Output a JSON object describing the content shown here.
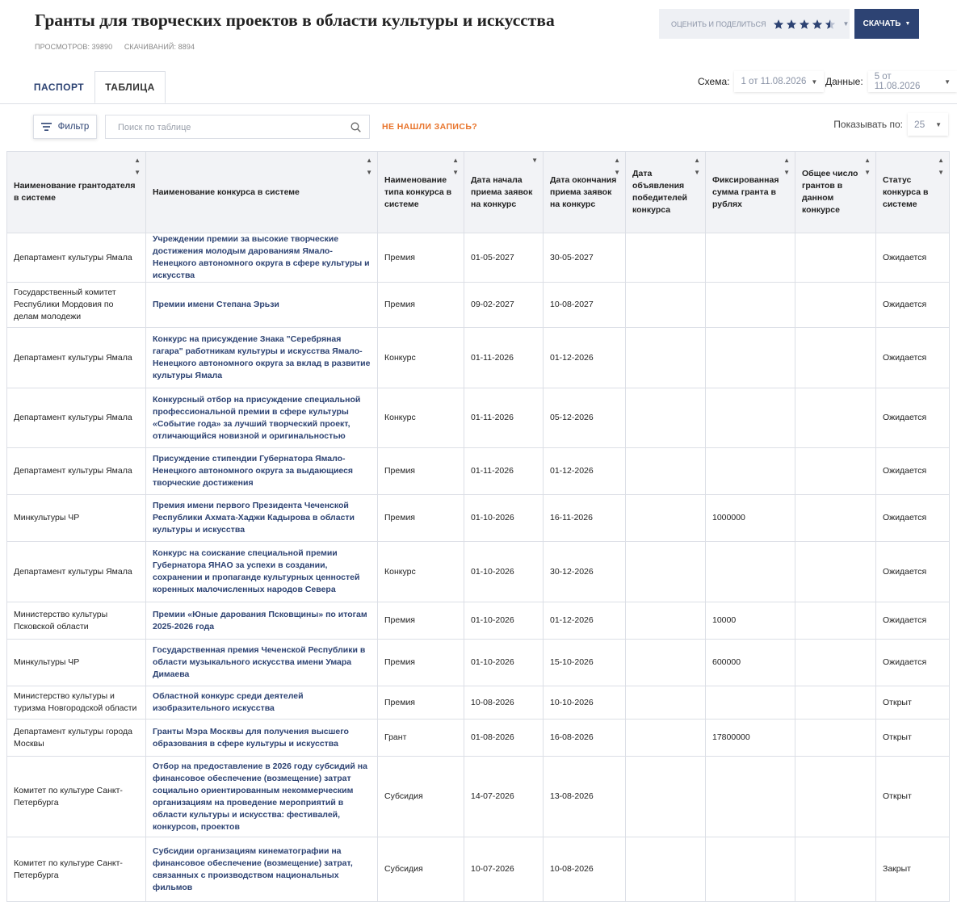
{
  "page": {
    "title": "Гранты для творческих проектов в области культуры и искусства",
    "views_label": "ПРОСМОТРОВ: 39890",
    "downloads_label": "СКАЧИВАНИЙ: 8894"
  },
  "toolbar": {
    "rate_label": "ОЦЕНИТЬ И ПОДЕЛИТЬСЯ",
    "rating_stars": 4.5,
    "download_label": "СКАЧАТЬ"
  },
  "tabs": {
    "passport": "ПАСПОРТ",
    "table": "ТАБЛИЦА"
  },
  "meta": {
    "schema_label": "Схема:",
    "schema_value": "1 от 11.08.2026",
    "data_label": "Данные:",
    "data_value": "5 от 11.08.2026"
  },
  "controls": {
    "filter_label": "Фильтр",
    "search_placeholder": "Поиск по таблице",
    "not_found_label": "НЕ НАШЛИ ЗАПИСЬ?",
    "page_size_label": "Показывать по:",
    "page_size_value": "25"
  },
  "colors": {
    "accent": "#2d4373",
    "orange": "#e8742b",
    "star": "#2d4373"
  },
  "icons": {
    "filter": "filter-icon",
    "search": "search-icon",
    "star": "star-icon"
  },
  "table": {
    "columns": [
      "Наименование грантодателя в системе",
      "Наименование конкурса в системе",
      "Наименование типа конкурса в системе",
      "Дата начала приема заявок на конкурс",
      "Дата окончания приема заявок на конкурс",
      "Дата объявления победителей конкурса",
      "Фиксированная сумма гранта в рублях",
      "Общее число грантов в данном конкурсе",
      "Статус конкурса в системе"
    ],
    "rows": [
      [
        "Департамент культуры Ямала",
        "Учреждении премии за высокие творческие достижения молодым дарованиям Ямало-Ненецкого автономного округа в сфере культуры и искусства",
        "Премия",
        "01-05-2027",
        "30-05-2027",
        "",
        "",
        "",
        "Ожидается"
      ],
      [
        "Государственный комитет Республики Мордовия по делам молодежи",
        "Премии имени Степана Эрьзи",
        "Премия",
        "09-02-2027",
        "10-08-2027",
        "",
        "",
        "",
        "Ожидается"
      ],
      [
        "Департамент культуры Ямала",
        "Конкурс на присуждение Знака \"Серебряная гагара\" работникам культуры и искусства Ямало-Ненецкого автономного округа за вклад в развитие культуры Ямала",
        "Конкурс",
        "01-11-2026",
        "01-12-2026",
        "",
        "",
        "",
        "Ожидается"
      ],
      [
        "Департамент культуры Ямала",
        "Конкурсный отбор на присуждение специальной профессиональной премии в сфере культуры «Событие года» за лучший творческий проект, отличающийся новизной и оригинальностью",
        "Конкурс",
        "01-11-2026",
        "05-12-2026",
        "",
        "",
        "",
        "Ожидается"
      ],
      [
        "Департамент культуры Ямала",
        "Присуждение стипендии Губернатора Ямало-Ненецкого автономного округа за выдающиеся творческие достижения",
        "Премия",
        "01-11-2026",
        "01-12-2026",
        "",
        "",
        "",
        "Ожидается"
      ],
      [
        "Минкультуры ЧР",
        "Премия имени первого Президента Чеченской Республики Ахмата-Хаджи Кадырова в области культуры и искусства",
        "Премия",
        "01-10-2026",
        "16-11-2026",
        "",
        "1000000",
        "",
        "Ожидается"
      ],
      [
        "Департамент культуры Ямала",
        "Конкурс на соискание специальной премии Губернатора ЯНАО за успехи в создании, сохранении и пропаганде культурных ценностей коренных малочисленных народов Севера",
        "Конкурс",
        "01-10-2026",
        "30-12-2026",
        "",
        "",
        "",
        "Ожидается"
      ],
      [
        "Министерство культуры Псковской области",
        "Премии «Юные дарования Псковщины» по итогам 2025-2026 года",
        "Премия",
        "01-10-2026",
        "01-12-2026",
        "",
        "10000",
        "",
        "Ожидается"
      ],
      [
        "Минкультуры ЧР",
        "Государственная премия Чеченской Республики в области музыкального искусства имени Умара Димаева",
        "Премия",
        "01-10-2026",
        "15-10-2026",
        "",
        "600000",
        "",
        "Ожидается"
      ],
      [
        "Министерство культуры и туризма Новгородской области",
        "Областной конкурс среди деятелей изобразительного искусства",
        "Премия",
        "10-08-2026",
        "10-10-2026",
        "",
        "",
        "",
        "Открыт"
      ],
      [
        "Департамент культуры города Москвы",
        "Гранты Мэра Москвы для получения высшего образования в сфере культуры и искусства",
        "Грант",
        "01-08-2026",
        "16-08-2026",
        "",
        "17800000",
        "",
        "Открыт"
      ],
      [
        "Комитет по культуре Санкт-Петербурга",
        "Отбор на предоставление в 2026 году субсидий на финансовое обеспечение (возмещение) затрат социально ориентированным некоммерческим организациям на проведение мероприятий в области культуры и искусства: фестивалей, конкурсов, проектов",
        "Субсидия",
        "14-07-2026",
        "13-08-2026",
        "",
        "",
        "",
        "Открыт"
      ],
      [
        "Комитет по культуре Санкт-Петербурга",
        "Субсидии организациям кинематографии на финансовое обеспечение (возмещение) затрат, связанных с производством национальных фильмов",
        "Субсидия",
        "10-07-2026",
        "10-08-2026",
        "",
        "",
        "",
        "Закрыт"
      ]
    ]
  }
}
